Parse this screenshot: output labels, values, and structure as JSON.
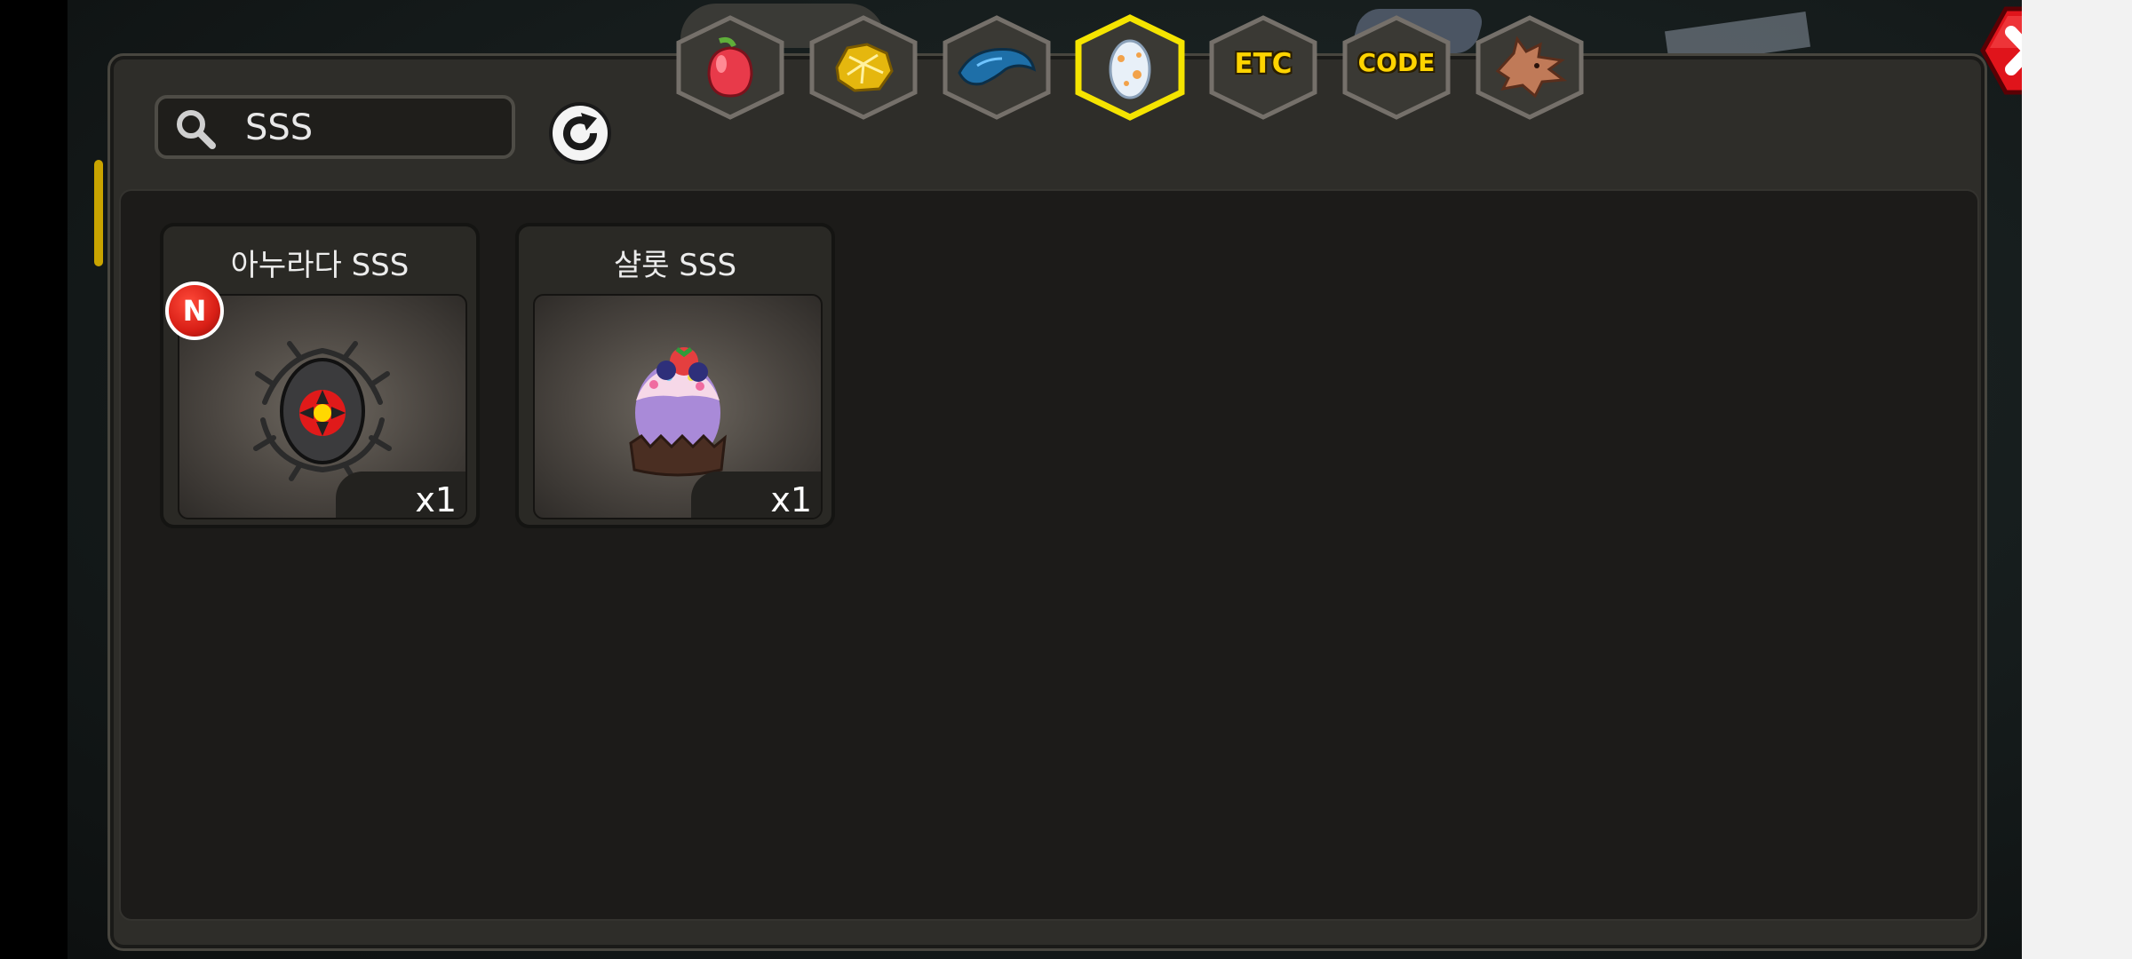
{
  "search": {
    "value": "SSS",
    "placeholder": ""
  },
  "tabs": [
    {
      "icon": "fruit-icon"
    },
    {
      "icon": "gold-icon"
    },
    {
      "icon": "fish-icon"
    },
    {
      "icon": "egg-icon",
      "active": true
    },
    {
      "label": "ETC"
    },
    {
      "label": "CODE"
    },
    {
      "icon": "dragon-icon"
    }
  ],
  "items": [
    {
      "name": "아누라다 SSS",
      "quantity": "x1",
      "badge": "N",
      "icon": "dark-egg-icon"
    },
    {
      "name": "샬롯 SSS",
      "quantity": "x1",
      "icon": "cake-egg-icon"
    }
  ],
  "colors": {
    "active_tab": "#f5e400",
    "close": "#e0141b",
    "tab_text": "#ffd400"
  }
}
